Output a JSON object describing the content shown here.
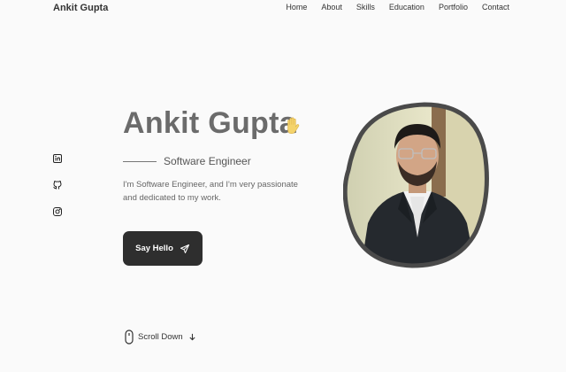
{
  "header": {
    "logo": "Ankit Gupta",
    "nav": [
      "Home",
      "About",
      "Skills",
      "Education",
      "Portfolio",
      "Contact"
    ]
  },
  "social": {
    "icons": [
      "linkedin-icon",
      "github-icon",
      "instagram-icon"
    ]
  },
  "hero": {
    "title": "Ankit Gupta",
    "subtitle": "Software Engineer",
    "description": "I'm Software Engineer, and I'm very passionate and dedicated to my work.",
    "button_label": "Say Hello",
    "scroll_label": "Scroll Down"
  },
  "colors": {
    "background": "#fafafa",
    "title": "#6b6b6b",
    "button_bg": "#2e2e2e",
    "wave": "#f4d36b"
  }
}
